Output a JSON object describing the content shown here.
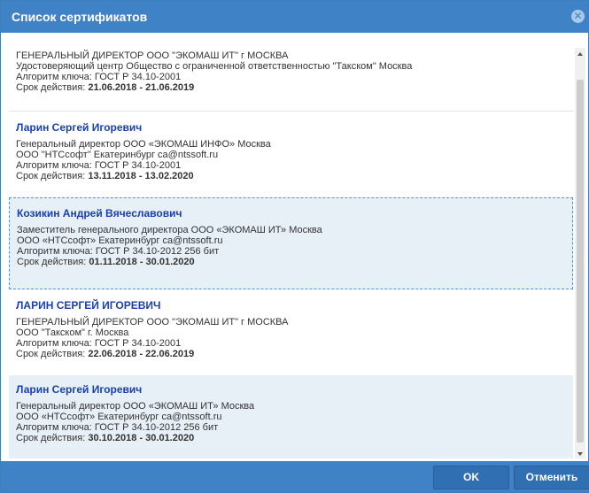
{
  "dialog": {
    "title": "Список сертификатов",
    "close_icon": "close-icon",
    "buttons": {
      "ok": "OK",
      "cancel": "Отменить"
    }
  },
  "certificates": [
    {
      "name": "",
      "position": "ГЕНЕРАЛЬНЫЙ ДИРЕКТОР ООО \"ЭКОМАШ ИТ\" г МОСКВА",
      "issuer": "Удостоверяющий центр Общество с ограниченной ответственностью \"Такском\" Москва",
      "algorithm": "Алгоритм ключа: ГОСТ Р 34.10-2001",
      "validity_label": "Срок действия: ",
      "validity": "21.06.2018 - 21.06.2019"
    },
    {
      "name": "Ларин Сергей Игоревич",
      "position": "Генеральный директор ООО «ЭКОМАШ ИНФО» Москва",
      "issuer": "ООО \"НТСсофт\" Екатеринбург ca@ntssoft.ru",
      "algorithm": "Алгоритм ключа: ГОСТ Р 34.10-2001",
      "validity_label": "Срок действия: ",
      "validity": "13.11.2018 - 13.02.2020"
    },
    {
      "name": "Козикин Андрей Вячеславович",
      "position": "Заместитель генерального директора ООО «ЭКОМАШ ИТ» Москва",
      "issuer": "ООО «НТСсофт» Екатеринбург ca@ntssoft.ru",
      "algorithm": "Алгоритм ключа: ГОСТ Р 34.10-2012 256 бит",
      "validity_label": "Срок действия: ",
      "validity": "01.11.2018 - 30.01.2020"
    },
    {
      "name": "ЛАРИН СЕРГЕЙ ИГОРЕВИЧ",
      "position": "ГЕНЕРАЛЬНЫЙ ДИРЕКТОР ООО \"ЭКОМАШ ИТ\" г МОСКВА",
      "issuer": "ООО \"Такском\" г. Москва",
      "algorithm": "Алгоритм ключа: ГОСТ Р 34.10-2001",
      "validity_label": "Срок действия: ",
      "validity": "22.06.2018 - 22.06.2019"
    },
    {
      "name": "Ларин Сергей Игоревич",
      "position": "Генеральный директор ООО «ЭКОМАШ ИТ» Москва",
      "issuer": "ООО «НТСсофт» Екатеринбург ca@ntssoft.ru",
      "algorithm": "Алгоритм ключа: ГОСТ Р 34.10-2012 256 бит",
      "validity_label": "Срок действия: ",
      "validity": "30.10.2018 - 30.01.2020"
    }
  ],
  "colors": {
    "titlebar": "#3f82c6",
    "name": "#1a3fb0",
    "selected_bg": "#e7eff7"
  }
}
